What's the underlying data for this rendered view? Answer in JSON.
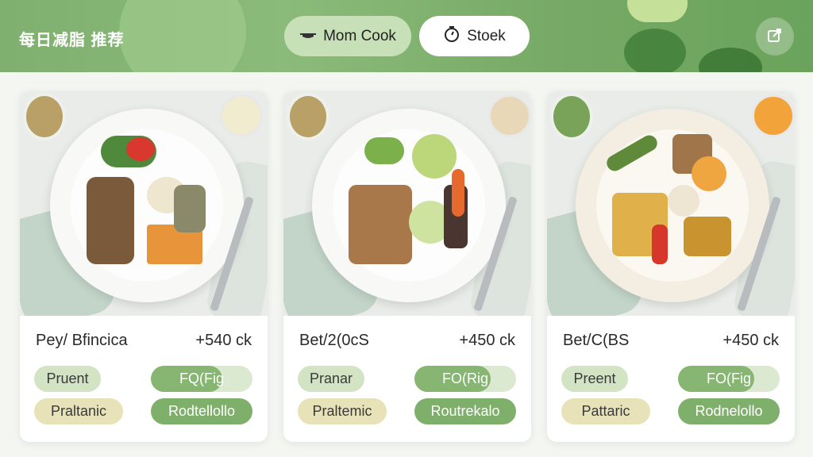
{
  "header": {
    "title": "每日减脂 推荐",
    "mode_button": {
      "icon": "pot-icon",
      "label": "Mom Cook",
      "bg": "#c8e0b8"
    },
    "stock_button": {
      "icon": "stopwatch-icon",
      "label": "Stoek",
      "bg": "#ffffff"
    },
    "share_icon": "share-icon",
    "accent": "#7fb070"
  },
  "cards": [
    {
      "name": "Pey/ Bfincica",
      "calories": "+540 ck",
      "tags": {
        "protein": "Pruent",
        "fiber": "FQ(Fig",
        "fiber_level": 0.7,
        "category": "Praltanic",
        "cook": "Rodtellollo"
      }
    },
    {
      "name": "Bet/2(0cS",
      "calories": "+450 ck",
      "tags": {
        "protein": "Pranar",
        "fiber": "FO(Rig",
        "fiber_level": 0.75,
        "category": "Praltemic",
        "cook": "Routrekalo"
      }
    },
    {
      "name": "Bet/C(BS",
      "calories": "+450 ck",
      "tags": {
        "protein": "Preent",
        "fiber": "FO(Fig",
        "fiber_level": 0.75,
        "category": "Pattaric",
        "cook": "Rodnelollo"
      }
    }
  ]
}
